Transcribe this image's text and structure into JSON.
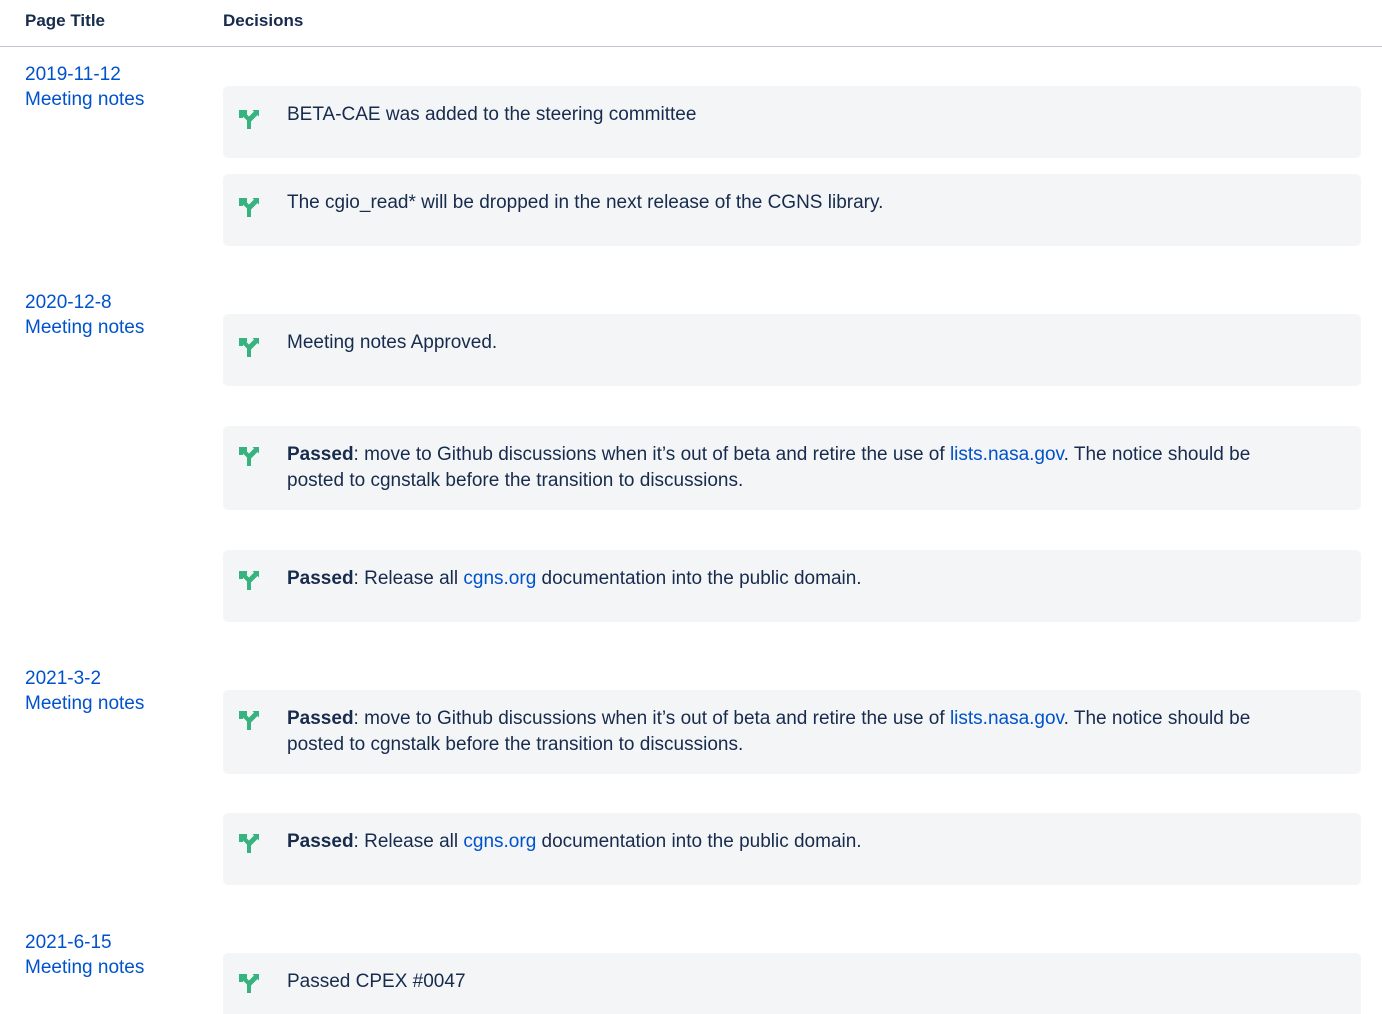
{
  "table": {
    "headers": {
      "page_title": "Page Title",
      "decisions": "Decisions"
    }
  },
  "rows": [
    {
      "date": "2019-11-12",
      "page": "Meeting notes",
      "decisions": [
        {
          "text": "BETA-CAE was added to the steering committee"
        },
        {
          "text": "The cgio_read* will be dropped in the next release of the CGNS library."
        }
      ]
    },
    {
      "date": "2020-12-8",
      "page": "Meeting notes",
      "decisions": [
        {
          "text": "Meeting notes Approved."
        },
        {
          "bold": "Passed",
          "pre": ": move to Github discussions when it’s out of beta and retire the use of ",
          "link": "lists.nasa.gov",
          "post": ". The notice should be posted to cgnstalk before the transition to discussions."
        },
        {
          "bold": "Passed",
          "pre": ": Release all ",
          "link": "cgns.org",
          "post": " documentation into the public domain."
        }
      ]
    },
    {
      "date": "2021-3-2",
      "page": "Meeting notes",
      "decisions": [
        {
          "bold": "Passed",
          "pre": ": move to Github discussions when it’s out of beta and retire the use of ",
          "link": "lists.nasa.gov",
          "post": ". The notice should be posted to cgnstalk before the transition to discussions."
        },
        {
          "bold": "Passed",
          "pre": ": Release all ",
          "link": "cgns.org",
          "post": " documentation into the public domain."
        }
      ]
    },
    {
      "date": "2021-6-15",
      "page": "Meeting notes",
      "decisions": [
        {
          "text": "Passed CPEX #0047"
        }
      ]
    }
  ],
  "colors": {
    "link": "#0052cc",
    "decision_icon": "#36b37e",
    "decision_bg": "#f4f5f7"
  },
  "icons": {
    "decision": "decision-branch-icon"
  }
}
